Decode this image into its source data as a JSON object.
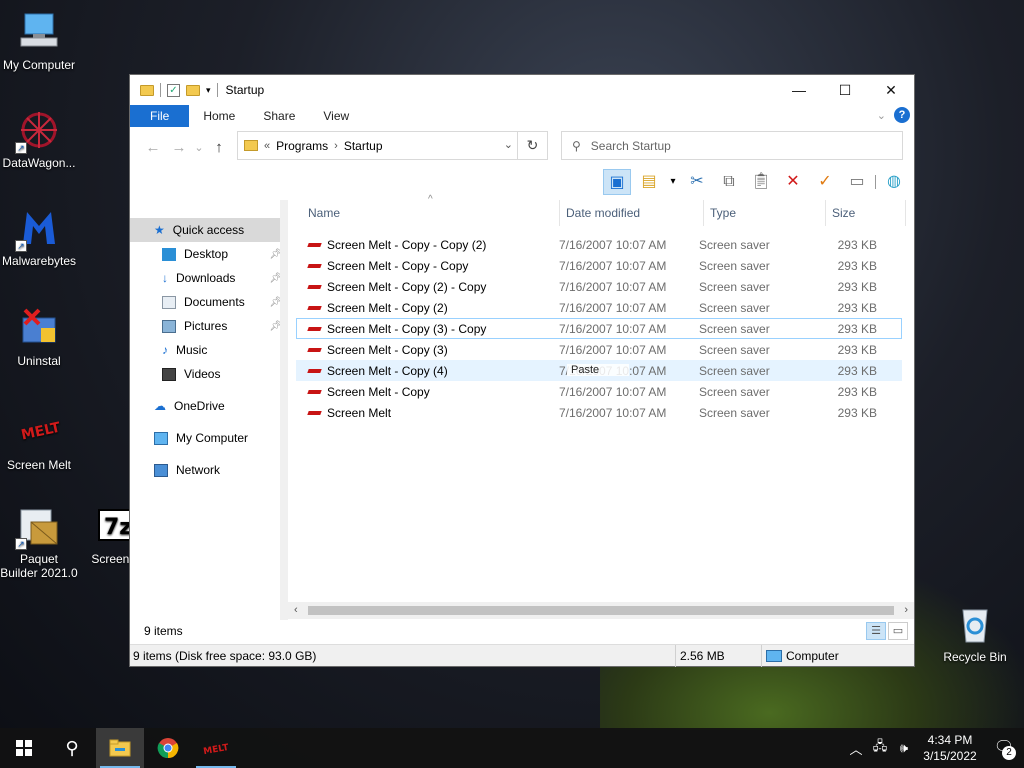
{
  "desktop": {
    "icons": [
      {
        "label": "My Computer"
      },
      {
        "label": "DataWagon..."
      },
      {
        "label": "Malwarebytes"
      },
      {
        "label": "Uninstal"
      },
      {
        "label": "Screen Melt"
      },
      {
        "label": "Paquet Builder 2021.0"
      },
      {
        "label": "Screen M"
      },
      {
        "label": "Recycle Bin"
      }
    ]
  },
  "window": {
    "title": "Startup",
    "controls": {
      "minimize": "—",
      "maximize": "☐",
      "close": "✕"
    },
    "ribbon_tabs": [
      "File",
      "Home",
      "Share",
      "View"
    ],
    "nav": {
      "back": "←",
      "forward": "→",
      "recent": "⌄",
      "up": "↑"
    },
    "address": {
      "overflow": "«",
      "crumbs": [
        "Programs",
        "Startup"
      ],
      "separator": "›"
    },
    "search": {
      "placeholder": "Search Startup"
    },
    "columns": {
      "name": "Name",
      "date": "Date modified",
      "type": "Type",
      "size": "Size"
    },
    "sidebar": [
      {
        "label": "Quick access"
      },
      {
        "label": "Desktop"
      },
      {
        "label": "Downloads"
      },
      {
        "label": "Documents"
      },
      {
        "label": "Pictures"
      },
      {
        "label": "Music"
      },
      {
        "label": "Videos"
      },
      {
        "label": "OneDrive"
      },
      {
        "label": "My Computer"
      },
      {
        "label": "Network"
      }
    ],
    "files": [
      {
        "name": "Screen Melt - Copy - Copy (2)",
        "date": "7/16/2007 10:07 AM",
        "type": "Screen saver",
        "size": "293 KB"
      },
      {
        "name": "Screen Melt - Copy - Copy",
        "date": "7/16/2007 10:07 AM",
        "type": "Screen saver",
        "size": "293 KB"
      },
      {
        "name": "Screen Melt - Copy (2) - Copy",
        "date": "7/16/2007 10:07 AM",
        "type": "Screen saver",
        "size": "293 KB"
      },
      {
        "name": "Screen Melt - Copy (2)",
        "date": "7/16/2007 10:07 AM",
        "type": "Screen saver",
        "size": "293 KB"
      },
      {
        "name": "Screen Melt - Copy (3) - Copy",
        "date": "7/16/2007 10:07 AM",
        "type": "Screen saver",
        "size": "293 KB"
      },
      {
        "name": "Screen Melt - Copy (3)",
        "date": "7/16/2007 10:07 AM",
        "type": "Screen saver",
        "size": "293 KB"
      },
      {
        "name": "Screen Melt - Copy (4)",
        "date": "7/16/2007 10:07 AM",
        "type": "Screen saver",
        "size": "293 KB"
      },
      {
        "name": "Screen Melt - Copy",
        "date": "7/16/2007 10:07 AM",
        "type": "Screen saver",
        "size": "293 KB"
      },
      {
        "name": "Screen Melt",
        "date": "7/16/2007 10:07 AM",
        "type": "Screen saver",
        "size": "293 KB"
      }
    ],
    "drag_tooltip": "Paste",
    "status": {
      "item_count": "9 items"
    },
    "details": {
      "summary": "9 items (Disk free space: 93.0 GB)",
      "size": "2.56 MB",
      "location": "Computer"
    }
  },
  "taskbar": {
    "time": "4:34 PM",
    "date": "3/15/2022",
    "notification_count": "2"
  },
  "colors": {
    "accent": "#1a6fd1",
    "selection": "#cce4f7",
    "melt_red": "#c81414"
  }
}
